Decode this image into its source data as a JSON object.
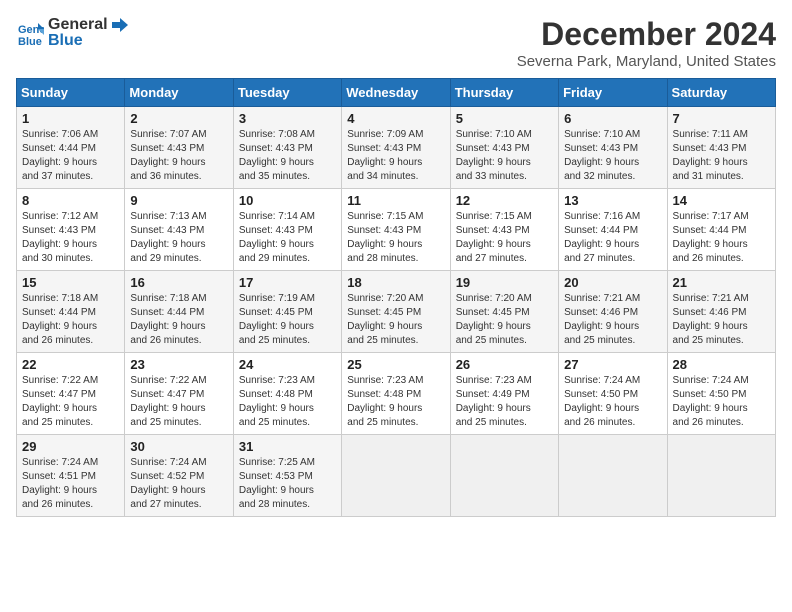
{
  "logo": {
    "line1": "General",
    "line2": "Blue"
  },
  "title": "December 2024",
  "subtitle": "Severna Park, Maryland, United States",
  "days_header": [
    "Sunday",
    "Monday",
    "Tuesday",
    "Wednesday",
    "Thursday",
    "Friday",
    "Saturday"
  ],
  "weeks": [
    [
      {
        "day": "1",
        "info": "Sunrise: 7:06 AM\nSunset: 4:44 PM\nDaylight: 9 hours\nand 37 minutes."
      },
      {
        "day": "2",
        "info": "Sunrise: 7:07 AM\nSunset: 4:43 PM\nDaylight: 9 hours\nand 36 minutes."
      },
      {
        "day": "3",
        "info": "Sunrise: 7:08 AM\nSunset: 4:43 PM\nDaylight: 9 hours\nand 35 minutes."
      },
      {
        "day": "4",
        "info": "Sunrise: 7:09 AM\nSunset: 4:43 PM\nDaylight: 9 hours\nand 34 minutes."
      },
      {
        "day": "5",
        "info": "Sunrise: 7:10 AM\nSunset: 4:43 PM\nDaylight: 9 hours\nand 33 minutes."
      },
      {
        "day": "6",
        "info": "Sunrise: 7:10 AM\nSunset: 4:43 PM\nDaylight: 9 hours\nand 32 minutes."
      },
      {
        "day": "7",
        "info": "Sunrise: 7:11 AM\nSunset: 4:43 PM\nDaylight: 9 hours\nand 31 minutes."
      }
    ],
    [
      {
        "day": "8",
        "info": "Sunrise: 7:12 AM\nSunset: 4:43 PM\nDaylight: 9 hours\nand 30 minutes."
      },
      {
        "day": "9",
        "info": "Sunrise: 7:13 AM\nSunset: 4:43 PM\nDaylight: 9 hours\nand 29 minutes."
      },
      {
        "day": "10",
        "info": "Sunrise: 7:14 AM\nSunset: 4:43 PM\nDaylight: 9 hours\nand 29 minutes."
      },
      {
        "day": "11",
        "info": "Sunrise: 7:15 AM\nSunset: 4:43 PM\nDaylight: 9 hours\nand 28 minutes."
      },
      {
        "day": "12",
        "info": "Sunrise: 7:15 AM\nSunset: 4:43 PM\nDaylight: 9 hours\nand 27 minutes."
      },
      {
        "day": "13",
        "info": "Sunrise: 7:16 AM\nSunset: 4:44 PM\nDaylight: 9 hours\nand 27 minutes."
      },
      {
        "day": "14",
        "info": "Sunrise: 7:17 AM\nSunset: 4:44 PM\nDaylight: 9 hours\nand 26 minutes."
      }
    ],
    [
      {
        "day": "15",
        "info": "Sunrise: 7:18 AM\nSunset: 4:44 PM\nDaylight: 9 hours\nand 26 minutes."
      },
      {
        "day": "16",
        "info": "Sunrise: 7:18 AM\nSunset: 4:44 PM\nDaylight: 9 hours\nand 26 minutes."
      },
      {
        "day": "17",
        "info": "Sunrise: 7:19 AM\nSunset: 4:45 PM\nDaylight: 9 hours\nand 25 minutes."
      },
      {
        "day": "18",
        "info": "Sunrise: 7:20 AM\nSunset: 4:45 PM\nDaylight: 9 hours\nand 25 minutes."
      },
      {
        "day": "19",
        "info": "Sunrise: 7:20 AM\nSunset: 4:45 PM\nDaylight: 9 hours\nand 25 minutes."
      },
      {
        "day": "20",
        "info": "Sunrise: 7:21 AM\nSunset: 4:46 PM\nDaylight: 9 hours\nand 25 minutes."
      },
      {
        "day": "21",
        "info": "Sunrise: 7:21 AM\nSunset: 4:46 PM\nDaylight: 9 hours\nand 25 minutes."
      }
    ],
    [
      {
        "day": "22",
        "info": "Sunrise: 7:22 AM\nSunset: 4:47 PM\nDaylight: 9 hours\nand 25 minutes."
      },
      {
        "day": "23",
        "info": "Sunrise: 7:22 AM\nSunset: 4:47 PM\nDaylight: 9 hours\nand 25 minutes."
      },
      {
        "day": "24",
        "info": "Sunrise: 7:23 AM\nSunset: 4:48 PM\nDaylight: 9 hours\nand 25 minutes."
      },
      {
        "day": "25",
        "info": "Sunrise: 7:23 AM\nSunset: 4:48 PM\nDaylight: 9 hours\nand 25 minutes."
      },
      {
        "day": "26",
        "info": "Sunrise: 7:23 AM\nSunset: 4:49 PM\nDaylight: 9 hours\nand 25 minutes."
      },
      {
        "day": "27",
        "info": "Sunrise: 7:24 AM\nSunset: 4:50 PM\nDaylight: 9 hours\nand 26 minutes."
      },
      {
        "day": "28",
        "info": "Sunrise: 7:24 AM\nSunset: 4:50 PM\nDaylight: 9 hours\nand 26 minutes."
      }
    ],
    [
      {
        "day": "29",
        "info": "Sunrise: 7:24 AM\nSunset: 4:51 PM\nDaylight: 9 hours\nand 26 minutes."
      },
      {
        "day": "30",
        "info": "Sunrise: 7:24 AM\nSunset: 4:52 PM\nDaylight: 9 hours\nand 27 minutes."
      },
      {
        "day": "31",
        "info": "Sunrise: 7:25 AM\nSunset: 4:53 PM\nDaylight: 9 hours\nand 28 minutes."
      },
      null,
      null,
      null,
      null
    ]
  ]
}
